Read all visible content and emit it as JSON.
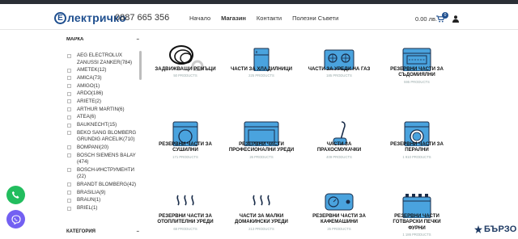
{
  "header": {
    "logo_mark": "E",
    "logo_text": "лектричко",
    "phone": "0887 665 356",
    "nav": [
      {
        "label": "Начало",
        "active": false
      },
      {
        "label": "Магазин",
        "active": true
      },
      {
        "label": "Контакти",
        "active": false
      },
      {
        "label": "Полезни Съвети",
        "active": false
      }
    ],
    "cart_total": "0.00 лв.",
    "cart_count": "0"
  },
  "sidebar": {
    "brand_heading": "МАРКА",
    "brand_toggle": "–",
    "brands": [
      "AEG ELECTROLUX ZANUSSI ZANKER(784)",
      "AMETEK(12)",
      "AMICA(73)",
      "AMIGO(1)",
      "ARDO(186)",
      "ARIETE(2)",
      "ARTHUR MARTIN(6)",
      "ATEA(6)",
      "BAUKNECHT(15)",
      "BEKO SANG BLOMBERG GRUNDIG ARCELIK(710)",
      "BOMPANI(20)",
      "BOSCH SIEMENS BALAY (474)",
      "BOSCH-ИНСТРУМЕНТИ (22)",
      "BRANDT BLOMBERG(42)",
      "BRASILIA(9)",
      "BRAUN(1)",
      "BRIEL(1)"
    ],
    "category_heading": "КАТЕГОРИЯ",
    "category_toggle": "–"
  },
  "categories": [
    {
      "label": "ЗАДВИЖВАЩИ РЕМЪЦИ",
      "count": "50 PRODUCTS",
      "icon": "belt-icon"
    },
    {
      "label": "ЧАСТИ ЗА ХЛАДИЛНИЦИ",
      "count": "225 PRODUCTS",
      "icon": "fridge-icon"
    },
    {
      "label": "ЧАСТИ ЗА УРЕДИ НА ГАЗ",
      "count": "185 PRODUCTS",
      "icon": "gas-stove-icon"
    },
    {
      "label": "РЕЗЕРВНИ ЧАСТИ ЗА СЪДОМИЯЛНИ",
      "count": "595 PRODUCTS",
      "icon": "dishwasher-icon"
    },
    {
      "label": "РЕЗЕРВНИ ЧАСТИ ЗА СУШИЛНИ",
      "count": "171 PRODUCTS",
      "icon": "dryer-icon"
    },
    {
      "label": "РЕЗЕРВНИ ЧАСТИ ПРОФЕСИОНАЛНИ УРЕДИ",
      "count": "26 PRODUCTS",
      "icon": "professional-oven-icon"
    },
    {
      "label": "ЧАСТИ ЗА ПРАХОСМУКАЧКИ",
      "count": "409 PRODUCTS",
      "icon": "vacuum-icon"
    },
    {
      "label": "РЕЗЕРВНИ ЧАСТИ ЗА ПЕРАЛНИ",
      "count": "1 910 PRODUCTS",
      "icon": "washer-icon"
    },
    {
      "label": "РЕЗЕРВНИ ЧАСТИ ЗА ОТОПЛИТЕЛНИ УРЕДИ",
      "count": "68 PRODUCTS",
      "icon": "heater-icon"
    },
    {
      "label": "ЧАСТИ ЗА МАЛКИ ДОМАКИНСКИ УРЕДИ",
      "count": "213 PRODUCTS",
      "icon": "small-appliance-icon"
    },
    {
      "label": "РЕЗЕРВНИ ЧАСТИ ЗА КАФЕМАШИНИ",
      "count": "25 PRODUCTS",
      "icon": "coffee-machine-icon"
    },
    {
      "label": "РЕЗЕРВНИ ЧАСТИ ГОТВАРСКИ ПЕЧКИ ФУРНИ",
      "count": "1 186 PRODUCTS",
      "icon": "cooker-icon"
    }
  ],
  "widgets": {
    "brand_badge": "БЪРЗО"
  },
  "colors": {
    "primary": "#1f4f8f",
    "icon_fill": "#4aa3de",
    "phone_fab": "#22bd5e",
    "viber_fab": "#7360f2"
  }
}
